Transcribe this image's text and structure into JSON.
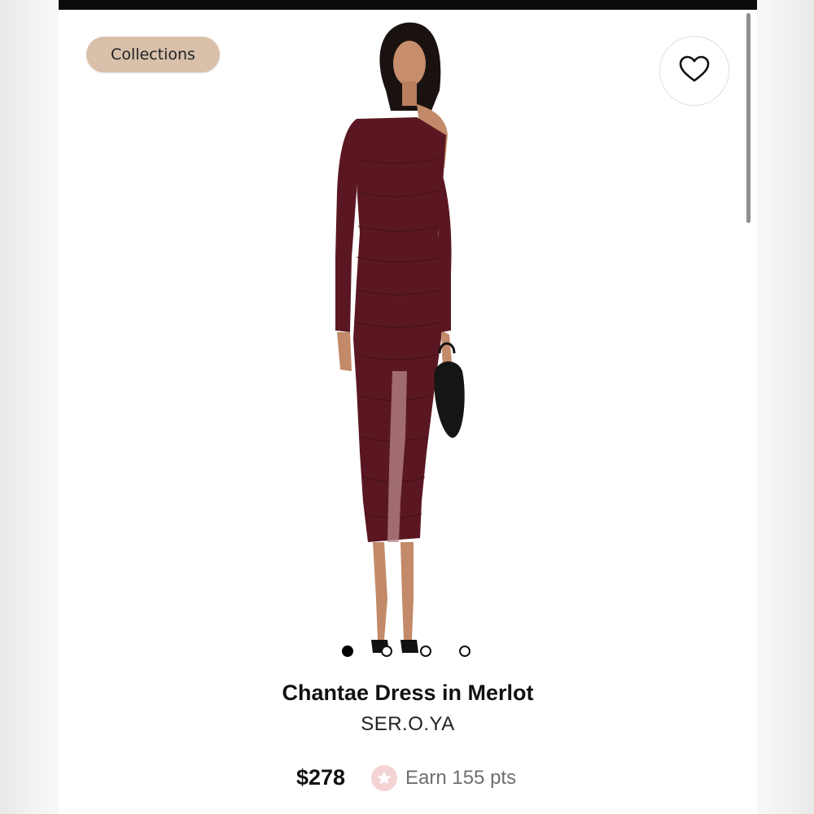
{
  "header": {
    "collections_label": "Collections"
  },
  "product": {
    "title": "Chantae Dress in Merlot",
    "brand": "SER.O.YA",
    "price": "$278",
    "points": "Earn 155 pts",
    "image_subject": "model wearing merlot one-shoulder ruched mesh midi dress with black handbag and heels",
    "dress_color": "#5a1722"
  },
  "carousel": {
    "count": 4,
    "active_index": 0
  },
  "colors": {
    "pill": "#d8c0aa",
    "points_badge": "#f4d3d3",
    "text": "#111111"
  },
  "icons": {
    "wishlist": "heart-icon",
    "points": "star-icon"
  }
}
